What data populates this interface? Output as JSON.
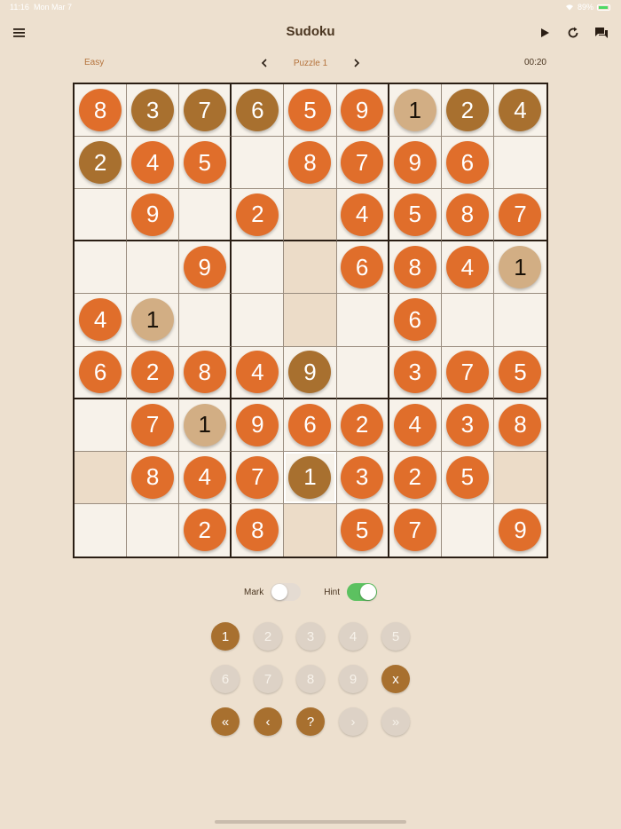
{
  "status": {
    "time": "11:16",
    "date": "Mon Mar 7",
    "battery": "89%"
  },
  "header": {
    "title": "Sudoku"
  },
  "info": {
    "difficulty": "Easy",
    "puzzle": "Puzzle 1",
    "timer": "00:20"
  },
  "board": {
    "rows": [
      [
        "8",
        "3",
        "7",
        "6",
        "5",
        "9",
        "1",
        "2",
        "4"
      ],
      [
        "2",
        "4",
        "5",
        "",
        "8",
        "7",
        "9",
        "6",
        ""
      ],
      [
        "",
        "9",
        "",
        "2",
        "",
        "4",
        "5",
        "8",
        "7"
      ],
      [
        "",
        "",
        "9",
        "",
        "",
        "6",
        "8",
        "4",
        "1"
      ],
      [
        "4",
        "1",
        "",
        "",
        "",
        "",
        "6",
        "",
        ""
      ],
      [
        "6",
        "2",
        "8",
        "4",
        "9",
        "",
        "3",
        "7",
        "5"
      ],
      [
        "",
        "7",
        "1",
        "9",
        "6",
        "2",
        "4",
        "3",
        "8"
      ],
      [
        "",
        "8",
        "4",
        "7",
        "1",
        "3",
        "2",
        "5",
        ""
      ],
      [
        "",
        "",
        "2",
        "8",
        "",
        "5",
        "7",
        "",
        "9"
      ]
    ],
    "styles": [
      [
        "given",
        "brown",
        "brown",
        "brown",
        "given",
        "given",
        "light",
        "brown",
        "brown"
      ],
      [
        "brown",
        "given",
        "given",
        "",
        "given",
        "given",
        "given",
        "given",
        ""
      ],
      [
        "",
        "given",
        "",
        "given",
        "",
        "given",
        "given",
        "given",
        "given"
      ],
      [
        "",
        "",
        "given",
        "",
        "",
        "given",
        "given",
        "given",
        "light"
      ],
      [
        "given",
        "light",
        "",
        "",
        "",
        "",
        "given",
        "",
        ""
      ],
      [
        "given",
        "given",
        "given",
        "given",
        "brown",
        "",
        "given",
        "given",
        "given"
      ],
      [
        "",
        "given",
        "light",
        "given",
        "given",
        "given",
        "given",
        "given",
        "given"
      ],
      [
        "",
        "given",
        "given",
        "given",
        "brown",
        "given",
        "given",
        "given",
        ""
      ],
      [
        "",
        "",
        "given",
        "given",
        "",
        "given",
        "given",
        "",
        "given"
      ]
    ],
    "selected": [
      7,
      4
    ]
  },
  "controls": {
    "mark_label": "Mark",
    "hint_label": "Hint",
    "mark_on": false,
    "hint_on": true
  },
  "keypad": {
    "rows": [
      [
        {
          "label": "1",
          "active": true
        },
        {
          "label": "2",
          "active": false
        },
        {
          "label": "3",
          "active": false
        },
        {
          "label": "4",
          "active": false
        },
        {
          "label": "5",
          "active": false
        }
      ],
      [
        {
          "label": "6",
          "active": false
        },
        {
          "label": "7",
          "active": false
        },
        {
          "label": "8",
          "active": false
        },
        {
          "label": "9",
          "active": false
        },
        {
          "label": "x",
          "active": true
        }
      ],
      [
        {
          "label": "«",
          "active": true
        },
        {
          "label": "‹",
          "active": true
        },
        {
          "label": "?",
          "active": true
        },
        {
          "label": "›",
          "active": false
        },
        {
          "label": "»",
          "active": false
        }
      ]
    ]
  },
  "colors": {
    "background": "#ede0cf",
    "given": "#e06e2b",
    "placed": "#a8702f",
    "light": "#d2ae84",
    "toggle_on": "#5cc160"
  }
}
